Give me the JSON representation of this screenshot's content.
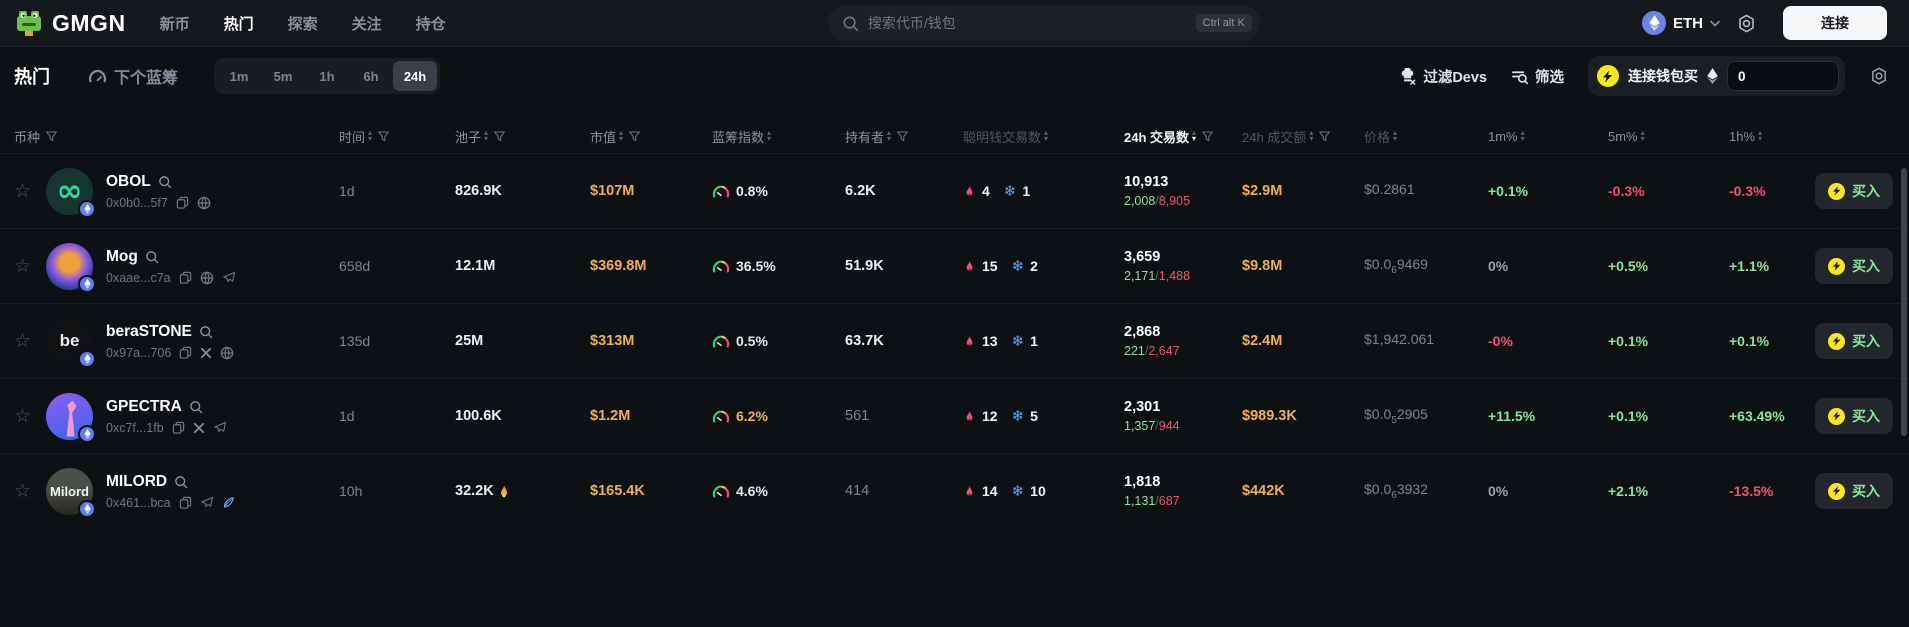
{
  "topnav": {
    "logo": "GMGN",
    "items": [
      {
        "key": "new",
        "label": "新币",
        "active": false
      },
      {
        "key": "hot",
        "label": "热门",
        "active": true
      },
      {
        "key": "explore",
        "label": "探索",
        "active": false
      },
      {
        "key": "watch",
        "label": "关注",
        "active": false
      },
      {
        "key": "holdings",
        "label": "持仓",
        "active": false
      }
    ],
    "search": {
      "placeholder": "搜索代币/钱包",
      "shortcut": "Ctrl alt K"
    },
    "chain": {
      "label": "ETH"
    },
    "connect_label": "连接"
  },
  "toolbar": {
    "title": "热门",
    "next_bluechip": "下个蓝筹",
    "timeframes": [
      "1m",
      "5m",
      "1h",
      "6h",
      "24h"
    ],
    "active_timeframe": "24h",
    "filter_devs": "过滤Devs",
    "filter": "筛选",
    "quick_buy": {
      "label": "连接钱包买",
      "amount": "0"
    }
  },
  "table": {
    "columns": [
      {
        "key": "token",
        "label": "币种",
        "funnel": true
      },
      {
        "key": "time",
        "label": "时间",
        "sort": true,
        "funnel": true
      },
      {
        "key": "pool",
        "label": "池子",
        "sort": true,
        "funnel": true
      },
      {
        "key": "mcap",
        "label": "市值",
        "sort": true,
        "funnel": true
      },
      {
        "key": "bluechip",
        "label": "蓝筹指数",
        "sort": true
      },
      {
        "key": "holders",
        "label": "持有者",
        "sort": true,
        "funnel": true
      },
      {
        "key": "smart",
        "label": "聪明钱交易数",
        "sort": true,
        "dim": true
      },
      {
        "key": "txs",
        "label": "24h 交易数",
        "sort": true,
        "funnel": true,
        "active": true
      },
      {
        "key": "vol",
        "label": "24h 成交额",
        "sort": true,
        "funnel": true,
        "dim": true
      },
      {
        "key": "price",
        "label": "价格",
        "sort": true,
        "dim": true
      },
      {
        "key": "m1",
        "label": "1m%",
        "sort": true
      },
      {
        "key": "m5",
        "label": "5m%",
        "sort": true
      },
      {
        "key": "h1",
        "label": "1h%",
        "sort": true
      },
      {
        "key": "buy",
        "label": ""
      }
    ],
    "rows": [
      {
        "name": "OBOL",
        "address": "0x0b0...5f7",
        "avatar_kind": "obol",
        "avatar_text": "∞",
        "socials": [
          "copy",
          "globe"
        ],
        "time": "1d",
        "pool": "826.9K",
        "pool_fire": false,
        "mcap": "$107M",
        "bluechip": "0.8%",
        "bluechip_tone": "normal",
        "holders": "6.2K",
        "holders_tone": "bright",
        "fire_count": "4",
        "snow_count": "1",
        "txs": "10,913",
        "txs_buys": "2,008",
        "txs_sells": "8,905",
        "volume": "$2.9M",
        "price_main": "$0.2861",
        "price_sub": "",
        "price_tail": "",
        "m1": "+0.1%",
        "m1_tone": "up",
        "m5": "-0.3%",
        "m5_tone": "down",
        "h1": "-0.3%",
        "h1_tone": "down",
        "buy_label": "买入"
      },
      {
        "name": "Mog",
        "address": "0xaae...c7a",
        "avatar_kind": "mog",
        "avatar_text": "",
        "socials": [
          "copy",
          "globe",
          "telegram"
        ],
        "time": "658d",
        "pool": "12.1M",
        "pool_fire": false,
        "mcap": "$369.8M",
        "bluechip": "36.5%",
        "bluechip_tone": "normal",
        "holders": "51.9K",
        "holders_tone": "bright",
        "fire_count": "15",
        "snow_count": "2",
        "txs": "3,659",
        "txs_buys": "2,171",
        "txs_sells": "1,488",
        "volume": "$9.8M",
        "price_main": "$0.0",
        "price_sub": "6",
        "price_tail": "9469",
        "m1": "0%",
        "m1_tone": "flat",
        "m5": "+0.5%",
        "m5_tone": "up",
        "h1": "+1.1%",
        "h1_tone": "up",
        "buy_label": "买入"
      },
      {
        "name": "beraSTONE",
        "address": "0x97a...706",
        "avatar_kind": "bera",
        "avatar_text": "be",
        "socials": [
          "copy",
          "x",
          "globe"
        ],
        "time": "135d",
        "pool": "25M",
        "pool_fire": false,
        "mcap": "$313M",
        "bluechip": "0.5%",
        "bluechip_tone": "normal",
        "holders": "63.7K",
        "holders_tone": "bright",
        "fire_count": "13",
        "snow_count": "1",
        "txs": "2,868",
        "txs_buys": "221",
        "txs_sells": "2,647",
        "volume": "$2.4M",
        "price_main": "$1,942.061",
        "price_sub": "",
        "price_tail": "",
        "m1": "-0%",
        "m1_tone": "down",
        "m5": "+0.1%",
        "m5_tone": "up",
        "h1": "+0.1%",
        "h1_tone": "up",
        "buy_label": "买入"
      },
      {
        "name": "GPECTRA",
        "address": "0xc7f...1fb",
        "avatar_kind": "gpectra",
        "avatar_text": "",
        "socials": [
          "copy",
          "x",
          "telegram"
        ],
        "time": "1d",
        "pool": "100.6K",
        "pool_fire": false,
        "mcap": "$1.2M",
        "bluechip": "6.2%",
        "bluechip_tone": "yellow",
        "holders": "561",
        "holders_tone": "dim",
        "fire_count": "12",
        "snow_count": "5",
        "txs": "2,301",
        "txs_buys": "1,357",
        "txs_sells": "944",
        "volume": "$989.3K",
        "price_main": "$0.0",
        "price_sub": "5",
        "price_tail": "2905",
        "m1": "+11.5%",
        "m1_tone": "up",
        "m5": "+0.1%",
        "m5_tone": "up",
        "h1": "+63.49%",
        "h1_tone": "up",
        "buy_label": "买入"
      },
      {
        "name": "MILORD",
        "address": "0x461...bca",
        "avatar_kind": "milord",
        "avatar_text": "Milord",
        "socials": [
          "copy",
          "feather",
          "telegram"
        ],
        "time": "10h",
        "pool": "32.2K",
        "pool_fire": true,
        "mcap": "$165.4K",
        "bluechip": "4.6%",
        "bluechip_tone": "normal",
        "holders": "414",
        "holders_tone": "dim",
        "fire_count": "14",
        "snow_count": "10",
        "txs": "1,818",
        "txs_buys": "1,131",
        "txs_sells": "687",
        "volume": "$442K",
        "price_main": "$0.0",
        "price_sub": "6",
        "price_tail": "3932",
        "m1": "0%",
        "m1_tone": "flat",
        "m5": "+2.1%",
        "m5_tone": "up",
        "h1": "-13.5%",
        "h1_tone": "down",
        "buy_label": "买入"
      }
    ]
  },
  "palette": {
    "background": "#0e1114",
    "accent_yellow": "#f3b04a",
    "up_green": "#8be49b",
    "down_red": "#f2516d",
    "snow_blue": "#55a9f8",
    "eth_blue": "#6b83e8",
    "bolt_yellow": "#f7e720",
    "text_dim": "#7c8590"
  }
}
